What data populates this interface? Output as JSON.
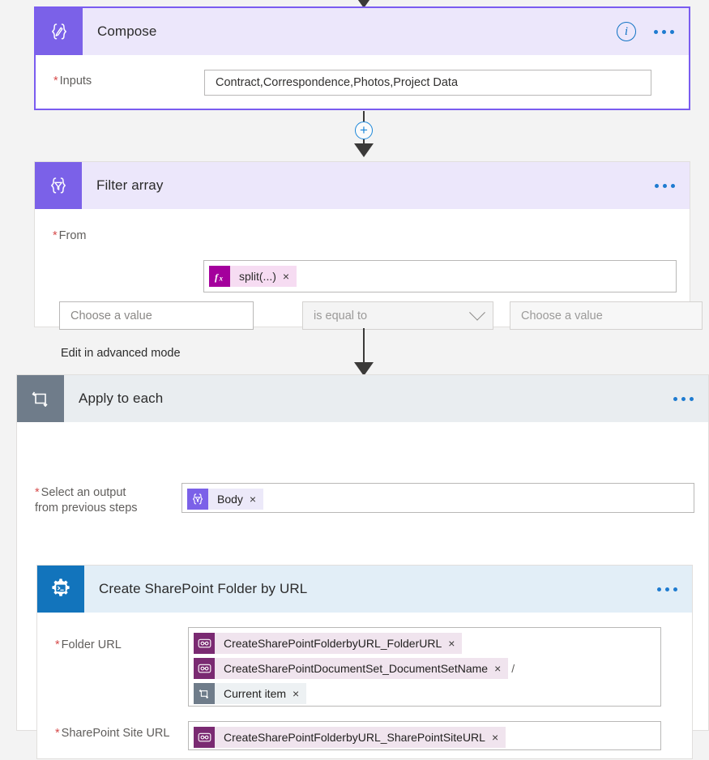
{
  "flow": {
    "top_connector": {
      "icon": "arrow-down-icon"
    },
    "cards": [
      {
        "id": "compose",
        "title": "Compose",
        "icon": "compose-braces-icon",
        "selected": true,
        "header_actions": {
          "info": "i",
          "more": "more-options-icon"
        },
        "fields": [
          {
            "label": "Inputs",
            "required": true,
            "type": "textbox",
            "value": "Contract,Correspondence,Photos,Project Data"
          }
        ]
      },
      {
        "id": "filter-array",
        "title": "Filter array",
        "icon": "filter-braces-icon",
        "selected": false,
        "header_actions": {
          "more": "more-options-icon"
        },
        "fields": [
          {
            "label": "From",
            "required": true,
            "type": "tokenbox",
            "tokens": [
              {
                "text": "split(...)",
                "style": "fx",
                "icon": "fx-icon",
                "remove": "×"
              }
            ]
          }
        ],
        "condition": {
          "left_placeholder": "Choose a value",
          "operator": "is equal to",
          "operator_icon": "chevron-down-icon",
          "right_placeholder": "Choose a value"
        },
        "advanced_link": "Edit in advanced mode"
      },
      {
        "id": "apply-to-each",
        "title": "Apply to each",
        "icon": "loop-icon",
        "selected": false,
        "header_actions": {
          "more": "more-options-icon"
        },
        "fields": [
          {
            "label": "Select an output\nfrom previous steps",
            "label_line1": "Select an output",
            "label_line2": "from previous steps",
            "required": true,
            "type": "tokenbox",
            "tokens": [
              {
                "text": "Body",
                "style": "purple",
                "icon": "filter-braces-icon",
                "remove": "×"
              }
            ]
          }
        ]
      },
      {
        "id": "create-sharepoint-folder",
        "title": "Create SharePoint Folder by URL",
        "icon": "gear-console-icon",
        "selected": false,
        "header_actions": {
          "more": "more-options-icon"
        },
        "fields": [
          {
            "label": "Folder URL",
            "required": true,
            "type": "tokenbox",
            "tokens": [
              {
                "text": "CreateSharePointFolderbyURL_FolderURL",
                "style": "magenta",
                "icon": "link-token-icon",
                "remove": "×"
              },
              {
                "text": "CreateSharePointDocumentSet_DocumentSetName",
                "style": "magenta",
                "icon": "link-token-icon",
                "remove": "×",
                "suffix": "/"
              },
              {
                "text": "Current item",
                "style": "grayloop",
                "icon": "loop-icon",
                "remove": "×"
              }
            ]
          },
          {
            "label": "SharePoint Site URL",
            "required": true,
            "type": "tokenbox",
            "tokens": [
              {
                "text": "CreateSharePointFolderbyURL_SharePointSiteURL",
                "style": "magenta",
                "icon": "link-token-icon",
                "remove": "×"
              }
            ]
          }
        ]
      }
    ],
    "connectors": [
      {
        "id": "compose-to-filter",
        "plus": "+",
        "icon": "arrow-down-icon"
      },
      {
        "id": "filter-to-apply",
        "icon": "arrow-down-icon"
      }
    ],
    "colors": {
      "accent_purple": "#7b61e8",
      "header_purple": "#ece7fb",
      "loop_gray": "#6f7c8a",
      "sharepoint_blue": "#1274bc",
      "link_blue": "#1e7bd0",
      "required_red": "#d64a4a",
      "fx_magenta": "#a4009c"
    }
  }
}
